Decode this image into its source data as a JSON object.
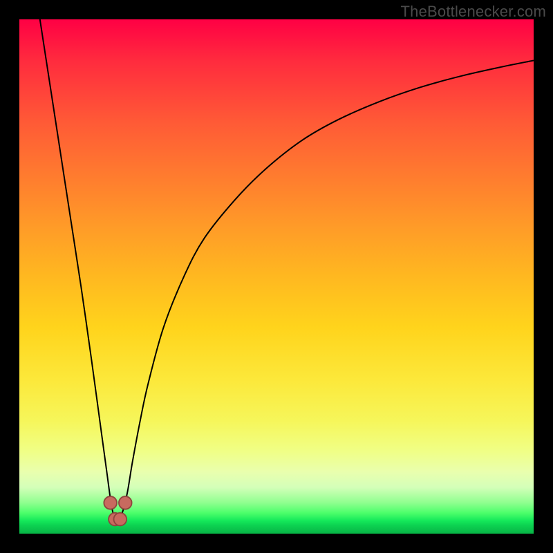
{
  "watermark": {
    "text": "TheBottlenecker.com"
  },
  "colors": {
    "frame_bg": "#000000",
    "curve": "#000000",
    "marker_fill": "#c86a5f",
    "marker_stroke": "#8e463e",
    "gradient_top": "#ff0044",
    "gradient_bottom": "#08b546"
  },
  "chart_data": {
    "type": "line",
    "title": "",
    "xlabel": "",
    "ylabel": "",
    "xlim": [
      0,
      100
    ],
    "ylim": [
      0,
      100
    ],
    "grid": false,
    "legend": false,
    "optimum_x": 19,
    "series": [
      {
        "name": "bottleneck-curve",
        "x": [
          4,
          6,
          8,
          10,
          12,
          14,
          15.5,
          17,
          18,
          19,
          20,
          21,
          22,
          23.5,
          25,
          28,
          32,
          36,
          42,
          48,
          55,
          62,
          70,
          78,
          86,
          94,
          100
        ],
        "values": [
          100,
          87,
          74,
          61,
          48,
          34,
          23,
          12,
          5,
          2,
          4,
          8,
          14,
          22,
          29,
          40,
          50,
          57.5,
          65,
          71,
          76.5,
          80.5,
          84,
          86.8,
          89,
          90.8,
          92
        ]
      }
    ],
    "markers": [
      {
        "x": 17.7,
        "y": 6.0
      },
      {
        "x": 18.6,
        "y": 2.8
      },
      {
        "x": 19.6,
        "y": 2.8
      },
      {
        "x": 20.6,
        "y": 6.0
      }
    ]
  }
}
